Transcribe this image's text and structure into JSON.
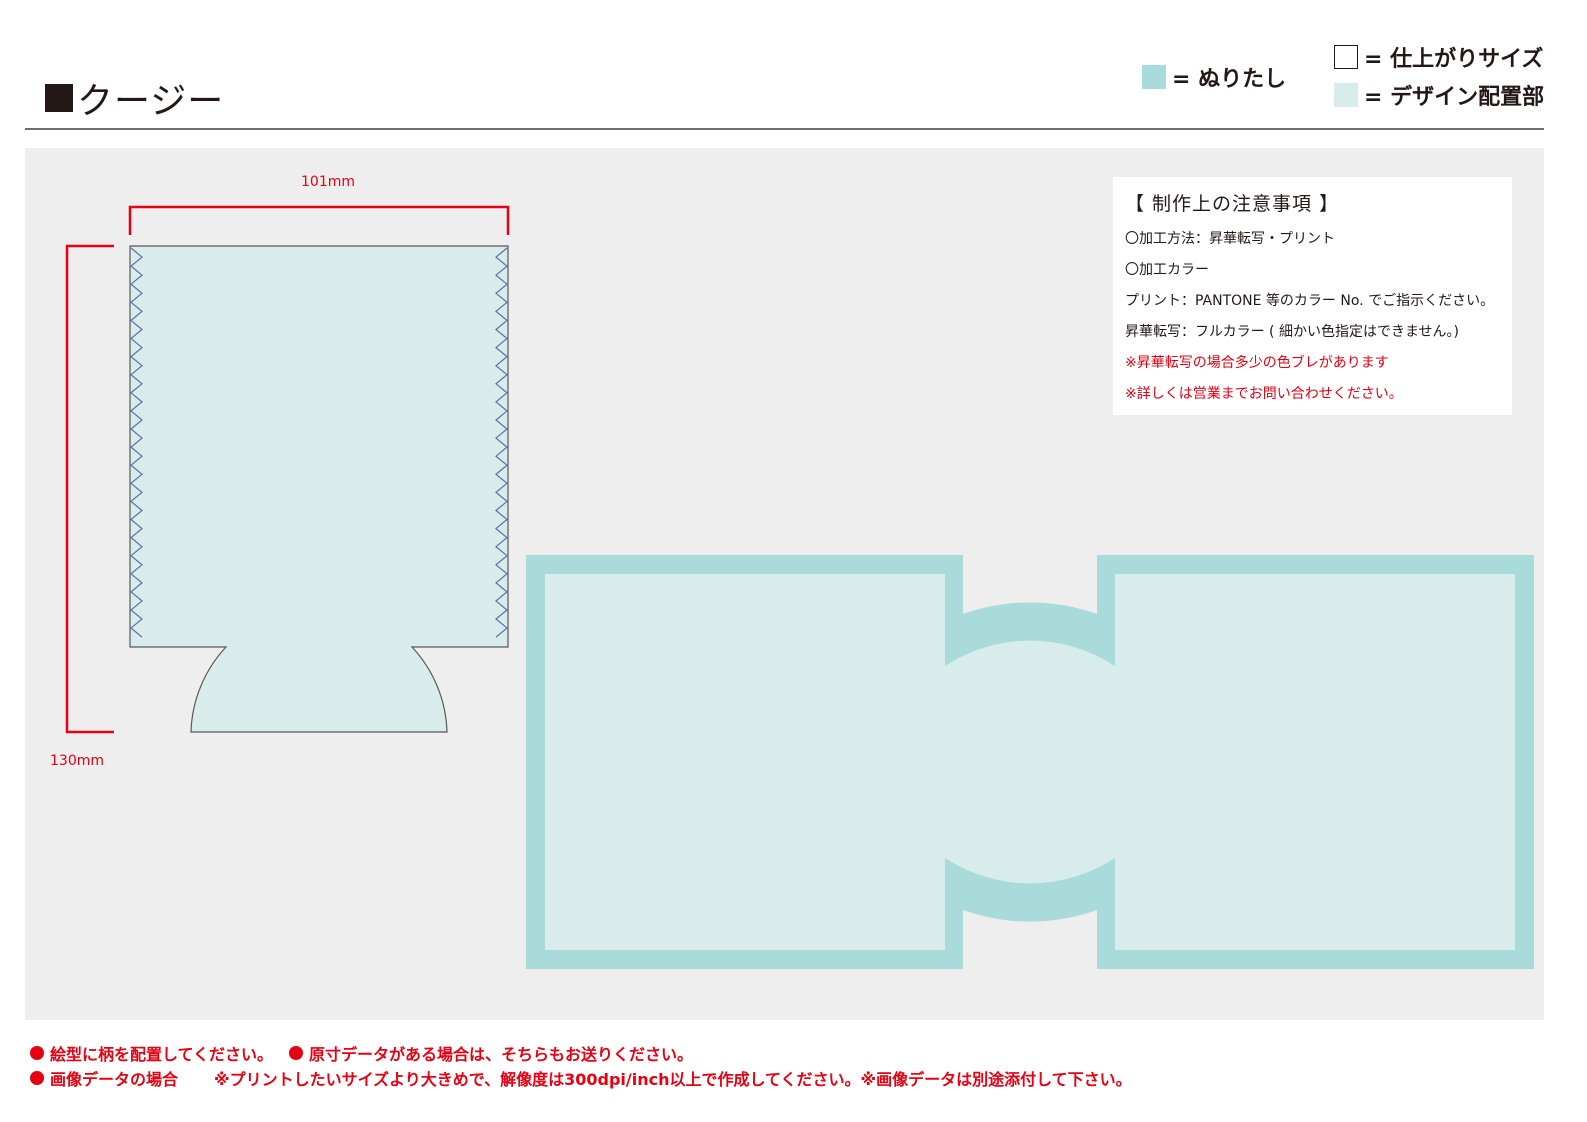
{
  "header": {
    "title": "クージー",
    "legend": {
      "bleed": "= ぬりたし",
      "finish": "= 仕上がりサイズ",
      "design": "= デザイン配置部"
    }
  },
  "colors": {
    "bleed": "#a8dbd9",
    "design_area": "#d8edeb",
    "accent_red": "#e60012",
    "dimension_line": "#e60012",
    "panel_bg": "#eeeeee"
  },
  "template": {
    "width_label": "101mm",
    "height_label": "130mm"
  },
  "notes": {
    "title": "【 制作上の注意事項 】",
    "lines": [
      "〇加工方法：昇華転写・プリント",
      "〇加工カラー",
      "プリント：PANTONE 等のカラー No. でご指示ください。",
      "昇華転写：フルカラー ( 細かい色指定はできません。)"
    ],
    "red_lines": [
      "※昇華転写の場合多少の色ブレがあります",
      "※詳しくは営業までお問い合わせください。"
    ]
  },
  "footer": {
    "item1": "絵型に柄を配置してください。",
    "item2": "原寸データがある場合は、そちらもお送りください。",
    "item3_label": "画像データの場合",
    "item3_text": "※プリントしたいサイズより大きめで、解像度は300dpi/inch以上で作成してください。※画像データは別途添付して下さい。"
  }
}
